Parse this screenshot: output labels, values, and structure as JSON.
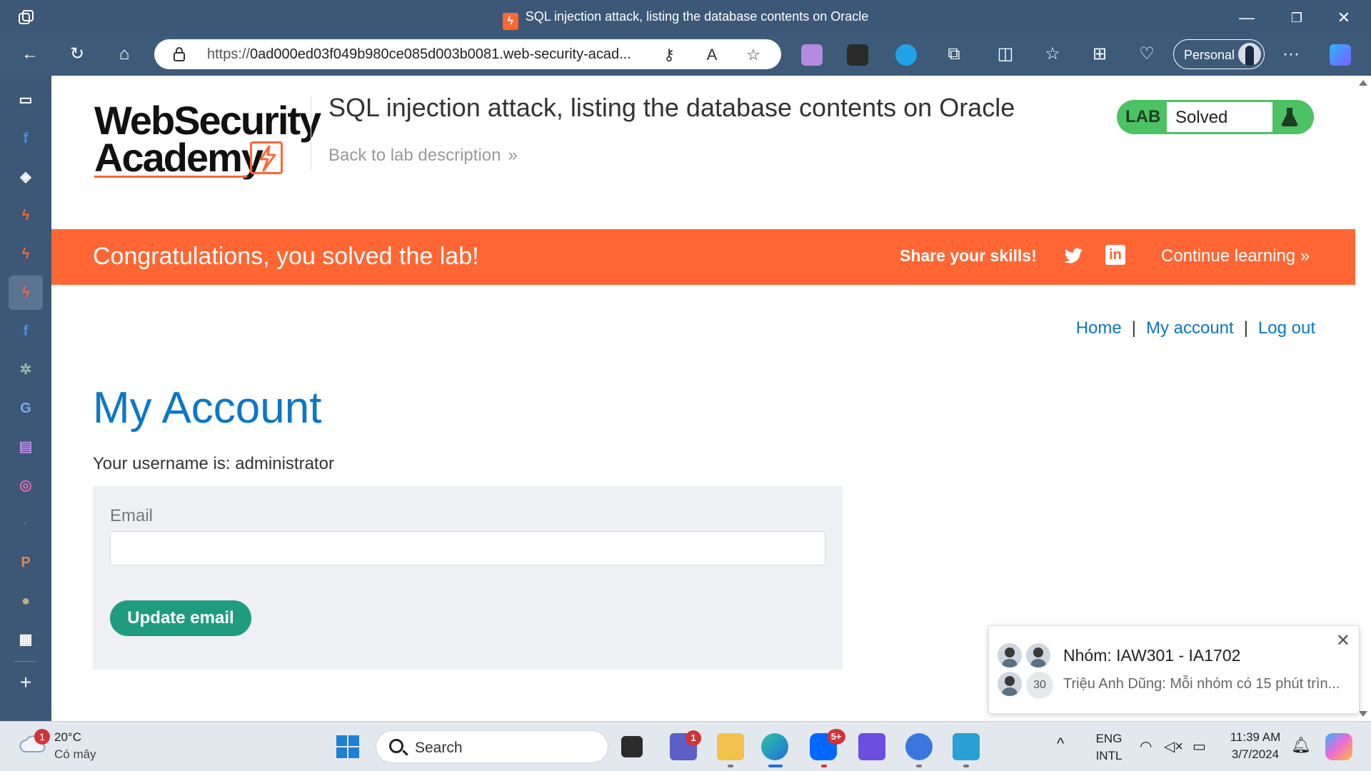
{
  "browser": {
    "window_title": "SQL injection attack, listing the database contents on Oracle",
    "url_prefix": "https://",
    "url_main": "0ad000ed03f049b980ce085d003b0081.web-security-acad...",
    "profile_label": "Personal"
  },
  "header": {
    "logo_line1": "WebSecurity",
    "logo_line2": "Academy",
    "lab_title": "SQL injection attack, listing the database contents on Oracle",
    "back_link": "Back to lab description",
    "badge_lab": "LAB",
    "badge_status": "Solved"
  },
  "banner": {
    "message": "Congratulations, you solved the lab!",
    "share": "Share your skills!",
    "continue": "Continue learning"
  },
  "nav": {
    "home": "Home",
    "my_account": "My account",
    "logout": "Log out",
    "separator": "|"
  },
  "main": {
    "heading": "My Account",
    "username_line": "Your username is: administrator",
    "email_label": "Email",
    "email_value": "",
    "update_button": "Update email"
  },
  "notification": {
    "group_name": "Nhóm: IAW301 - IA1702",
    "message": "Triệu Anh Dũng: Mỗi nhóm có 15 phút trìn...",
    "member_count": "30"
  },
  "taskbar": {
    "temperature": "20°C",
    "weather_desc": "Có mây",
    "weather_badge": "1",
    "search_placeholder": "Search",
    "teams_badge": "1",
    "zalo_badge": "5+",
    "lang_line1": "ENG",
    "lang_line2": "INTL",
    "time": "11:39 AM",
    "date": "3/7/2024"
  },
  "colors": {
    "accent_orange": "#ff6633",
    "link_blue": "#0b77c7",
    "button_green": "#1f9c7f",
    "badge_green": "#4cc264",
    "chrome": "#3c5876"
  }
}
